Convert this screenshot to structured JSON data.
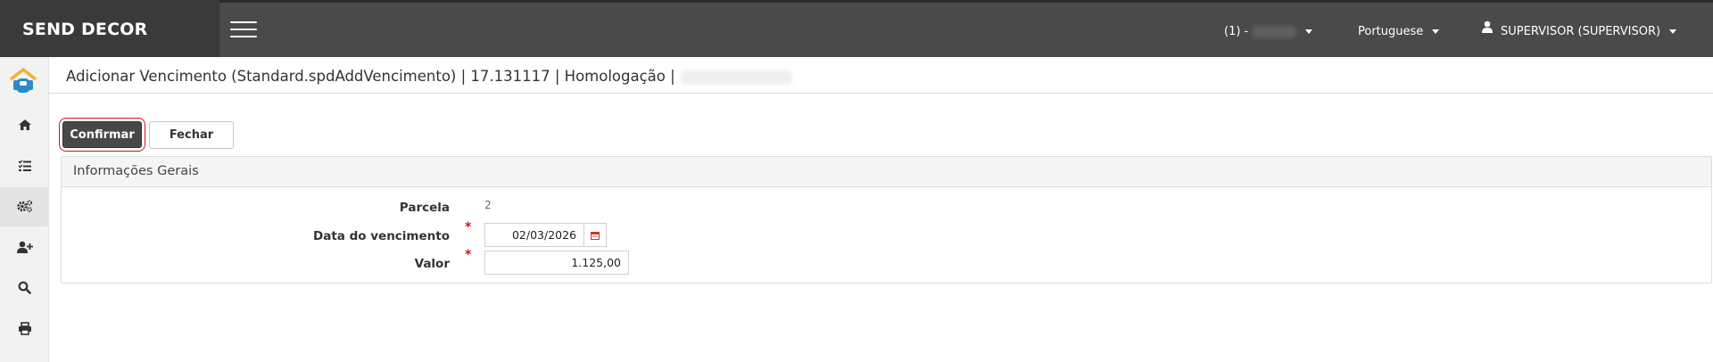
{
  "header": {
    "brand": "SEND DECOR",
    "company_label": "(1) -",
    "language": "Portuguese",
    "user": "SUPERVISOR (SUPERVISOR)"
  },
  "sidebar": {
    "items": [
      {
        "icon": "home-icon"
      },
      {
        "icon": "checklist-icon"
      },
      {
        "icon": "gears-icon",
        "active": true
      },
      {
        "icon": "user-plus-icon"
      },
      {
        "icon": "search-icon"
      },
      {
        "icon": "print-icon"
      }
    ]
  },
  "page": {
    "title": "Adicionar Vencimento (Standard.spdAddVencimento) | 17.131117 | Homologação |"
  },
  "toolbar": {
    "confirm_label": "Confirmar",
    "close_label": "Fechar"
  },
  "panel": {
    "title": "Informações Gerais",
    "fields": {
      "parcela_label": "Parcela",
      "parcela_value": "2",
      "data_label": "Data do vencimento",
      "data_value": "02/03/2026",
      "valor_label": "Valor",
      "valor_value": "1.125,00",
      "required_mark": "*"
    }
  },
  "colors": {
    "topbar": "#4a4a4a",
    "brand_bg": "#3a3a3a",
    "confirm_bg": "#484848",
    "focus_ring": "#d0141c",
    "required": "#d0141c"
  }
}
